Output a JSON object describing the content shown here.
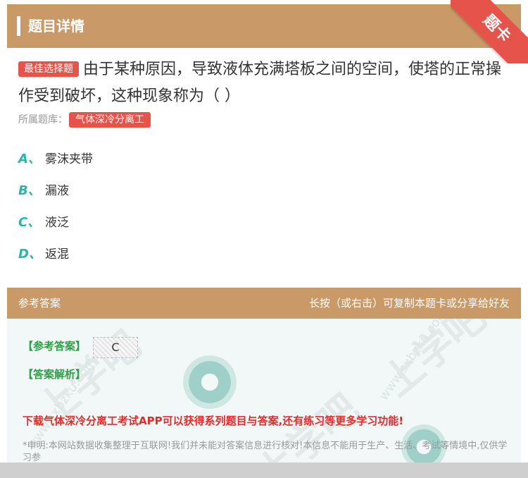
{
  "header": {
    "title": "题目详情"
  },
  "ribbon": {
    "label": "题卡"
  },
  "question": {
    "type_badge": "最佳选择题",
    "text": "由于某种原因，导致液体充满塔板之间的空间，使塔的正常操作受到破坏，这种现象称为（ ）"
  },
  "library": {
    "label": "所属题库：",
    "tag": "气体深冷分离工"
  },
  "options": [
    {
      "letter": "A、",
      "text": "雾沫夹带"
    },
    {
      "letter": "B、",
      "text": "漏液"
    },
    {
      "letter": "C、",
      "text": "液泛"
    },
    {
      "letter": "D、",
      "text": "返混"
    }
  ],
  "answer_header": {
    "left": "参考答案",
    "right": "长按（或右击）可复制本题卡或分享给好友"
  },
  "answer": {
    "ref_label": "【参考答案】",
    "ref_value": "C",
    "analysis_label": "【答案解析】",
    "promo": "下载气体深冷分离工考试APP可以获得系列题目与答案,还有练习等更多学习功能!",
    "disclaimer": "*申明:本网站数据收集整理于互联网!我们并未能对答案信息进行核对!本信息不能用于生产、生活、考试等情境中,仅供学习参"
  },
  "watermark": {
    "text": "上学吧",
    "site": "www.sxbzku.com"
  },
  "colors": {
    "header": "#c99a68",
    "accent_red": "#e5534b",
    "option_letter": "#2bb5a8",
    "answer_green": "#2ca045",
    "promo_red": "#e52a2a"
  }
}
